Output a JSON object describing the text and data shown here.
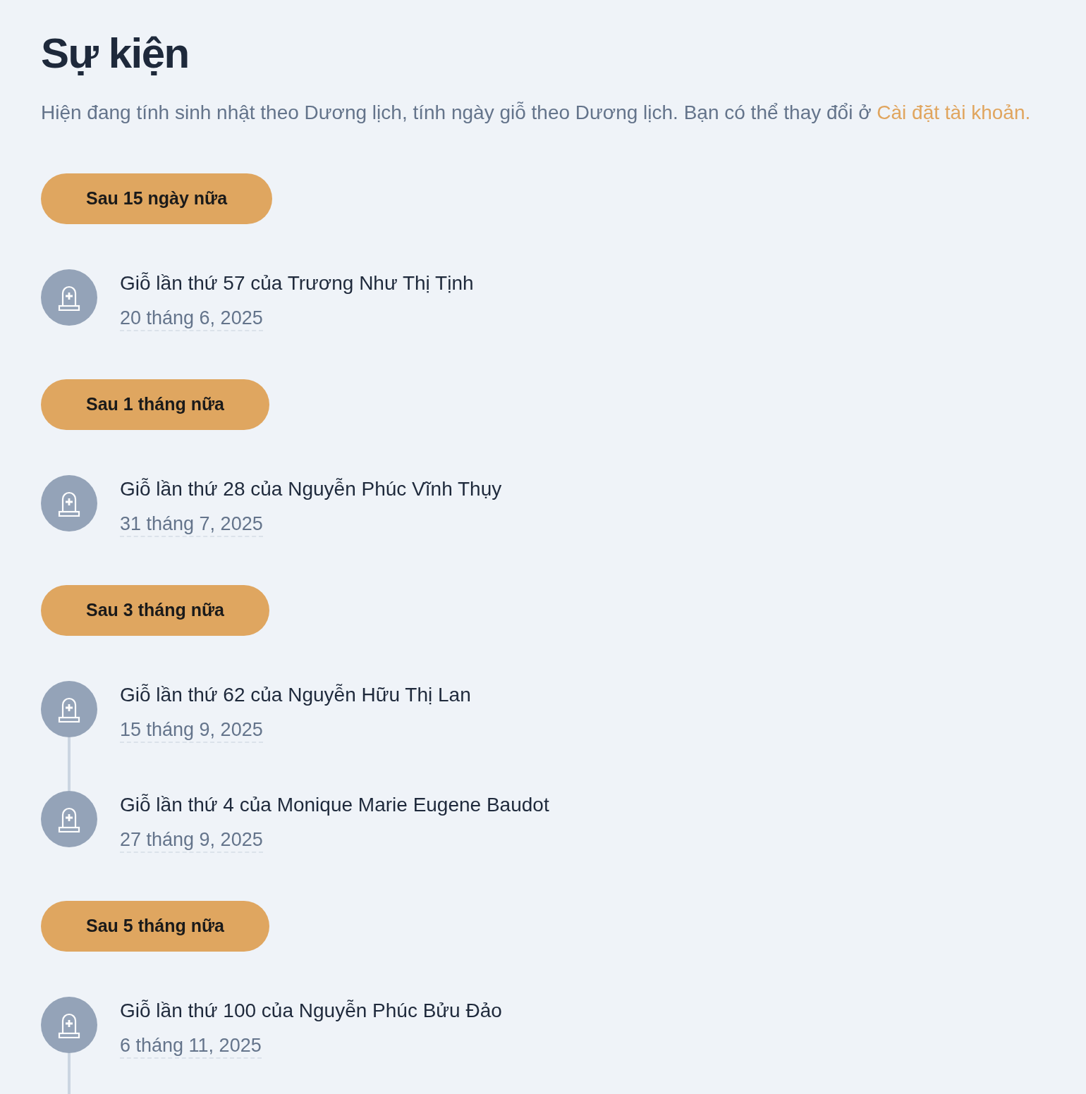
{
  "page": {
    "title": "Sự kiện",
    "description": "Hiện đang tính sinh nhật theo Dương lịch, tính ngày giỗ theo Dương lịch. Bạn có thể thay đổi ở",
    "settings_link": "Cài đặt tài khoản."
  },
  "groups": [
    {
      "label": "Sau 15 ngày nữa",
      "events": [
        {
          "title": "Giỗ lần thứ 57 của Trương Như Thị Tịnh",
          "date": "20 tháng 6, 2025",
          "connector_below": false
        }
      ]
    },
    {
      "label": "Sau 1 tháng nữa",
      "events": [
        {
          "title": "Giỗ lần thứ 28 của Nguyễn Phúc Vĩnh Thụy",
          "date": "31 tháng 7, 2025",
          "connector_below": false
        }
      ]
    },
    {
      "label": "Sau 3 tháng nữa",
      "events": [
        {
          "title": "Giỗ lần thứ 62 của Nguyễn Hữu Thị Lan",
          "date": "15 tháng 9, 2025",
          "connector_below": true
        },
        {
          "title": "Giỗ lần thứ 4 của Monique Marie Eugene Baudot",
          "date": "27 tháng 9, 2025",
          "connector_below": false
        }
      ]
    },
    {
      "label": "Sau 5 tháng nữa",
      "events": [
        {
          "title": "Giỗ lần thứ 100 của Nguyễn Phúc Bửu Đảo",
          "date": "6 tháng 11, 2025",
          "connector_below": true
        }
      ]
    }
  ]
}
